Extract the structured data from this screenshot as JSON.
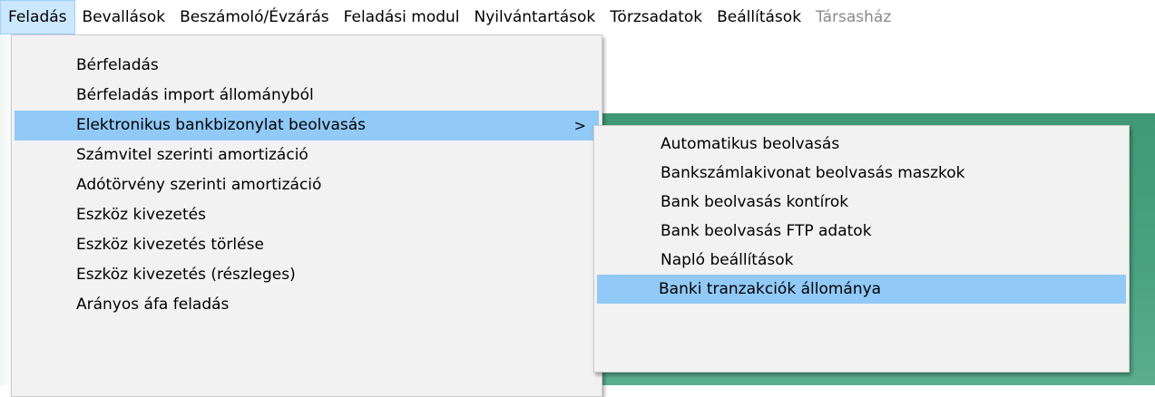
{
  "menubar": {
    "items": [
      {
        "label": "Feladás"
      },
      {
        "label": "Bevallások"
      },
      {
        "label": "Beszámoló/Évzárás"
      },
      {
        "label": "Feladási modul"
      },
      {
        "label": "Nyilvántartások"
      },
      {
        "label": "Törzsadatok"
      },
      {
        "label": "Beállítások"
      },
      {
        "label": "Társasház"
      }
    ]
  },
  "main_menu": {
    "items": [
      {
        "label": "Bérfeladás"
      },
      {
        "label": "Bérfeladás import állományból"
      },
      {
        "label": "Elektronikus bankbizonylat beolvasás",
        "submenu_arrow": ">"
      },
      {
        "label": "Számvitel szerinti amortizáció"
      },
      {
        "label": "Adótörvény szerinti amortizáció"
      },
      {
        "label": "Eszköz kivezetés"
      },
      {
        "label": "Eszköz kivezetés törlése"
      },
      {
        "label": "Eszköz kivezetés (részleges)"
      },
      {
        "label": "Arányos áfa feladás"
      }
    ]
  },
  "sub_menu": {
    "items": [
      {
        "label": "Automatikus beolvasás"
      },
      {
        "label": "Bankszámlakivonat beolvasás maszkok"
      },
      {
        "label": "Bank beolvasás kontírok"
      },
      {
        "label": "Bank beolvasás FTP adatok"
      },
      {
        "label": "Napló beállítások"
      },
      {
        "label": "Banki tranzakciók állománya"
      }
    ]
  },
  "colors": {
    "menu_highlight": "#91c9f7",
    "menubar_active": "#cce8ff",
    "app_background_green": "#4aa383"
  }
}
